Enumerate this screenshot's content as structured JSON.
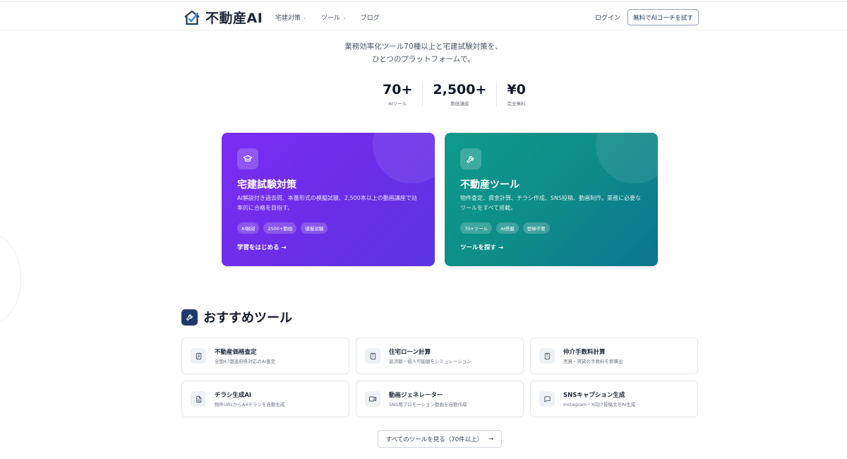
{
  "header": {
    "logo_text": "不動産AI",
    "nav": [
      {
        "label": "宅建対策",
        "has_dropdown": true
      },
      {
        "label": "ツール",
        "has_dropdown": true
      },
      {
        "label": "ブログ",
        "has_dropdown": false
      }
    ],
    "login_label": "ログイン",
    "cta_label": "無料でAIコーチを試す"
  },
  "hero": {
    "tagline_line1": "業務効率化ツール70種以上と宅建試験対策を、",
    "tagline_line2": "ひとつのプラットフォームで。",
    "stats": [
      {
        "value": "70+",
        "label": "AIツール"
      },
      {
        "value": "2,500+",
        "label": "動画講座"
      },
      {
        "value": "¥0",
        "label": "完全無料"
      }
    ]
  },
  "cards": {
    "exam": {
      "title": "宅建試験対策",
      "desc": "AI解説付き過去問、本番形式の模擬試験、2,500本以上の動画講座で効率的に合格を目指す。",
      "tags": [
        "AI解説",
        "2500+動画",
        "模擬試験"
      ],
      "link": "学習をはじめる",
      "icon": "graduation-cap-icon",
      "color": "#7c2cf2"
    },
    "tools": {
      "title": "不動産ツール",
      "desc": "物件査定、資金計算、チラシ作成、SNS投稿、動画制作。業務に必要なツールをすべて搭載。",
      "tags": [
        "70+ツール",
        "AI搭載",
        "登録不要"
      ],
      "link": "ツールを探す",
      "icon": "wrench-icon",
      "color": "#0f9b8a"
    }
  },
  "recommended": {
    "title": "おすすめツール",
    "tools": [
      {
        "name": "不動産価格査定",
        "desc": "全国47都道府県対応のAI査定",
        "icon": "document-icon"
      },
      {
        "name": "住宅ローン計算",
        "desc": "返済額・借入可能額をシミュレーション",
        "icon": "calculator-icon"
      },
      {
        "name": "仲介手数料計算",
        "desc": "売買・賃貸の手数料を即算出",
        "icon": "calculator-icon"
      },
      {
        "name": "チラシ生成AI",
        "desc": "物件URLからA4チラシを自動生成",
        "icon": "file-icon"
      },
      {
        "name": "動画ジェネレーター",
        "desc": "SNS用プロモーション動画を自動作成",
        "icon": "video-icon"
      },
      {
        "name": "SNSキャプション生成",
        "desc": "Instagram・X向け投稿文をAI生成",
        "icon": "chat-icon"
      }
    ],
    "all_button": "すべてのツールを見る（70件以上）"
  }
}
